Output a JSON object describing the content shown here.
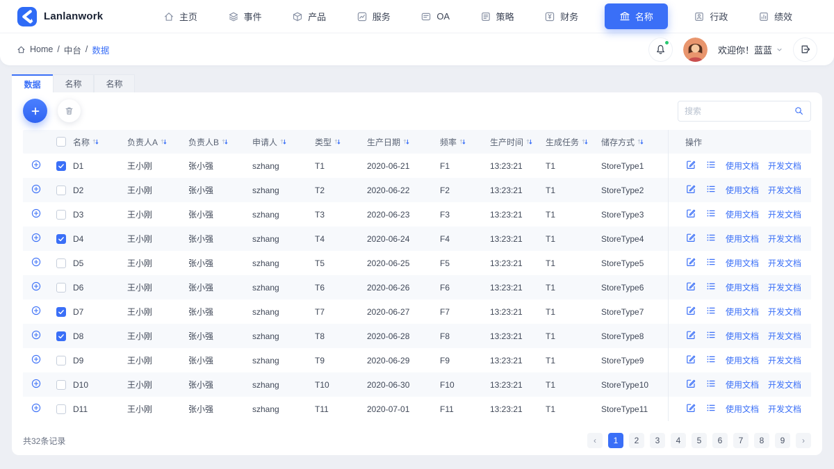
{
  "brand": {
    "name": "Lanlanwork"
  },
  "nav": {
    "items": [
      {
        "label": "主页",
        "icon": "home",
        "active": false
      },
      {
        "label": "事件",
        "icon": "layers",
        "active": false
      },
      {
        "label": "产品",
        "icon": "box",
        "active": false
      },
      {
        "label": "服务",
        "icon": "chart",
        "active": false
      },
      {
        "label": "OA",
        "icon": "oa",
        "active": false
      },
      {
        "label": "策略",
        "icon": "strategy",
        "active": false
      },
      {
        "label": "财务",
        "icon": "finance",
        "active": false
      },
      {
        "label": "名称",
        "icon": "bank",
        "active": true
      },
      {
        "label": "行政",
        "icon": "admin",
        "active": false
      },
      {
        "label": "绩效",
        "icon": "performance",
        "active": false
      }
    ]
  },
  "header": {
    "breadcrumb": {
      "root": "Home",
      "separator1": "/",
      "section": "中台",
      "separator2": "/",
      "current": "数据"
    },
    "greeting": "欢迎你！蓝蓝"
  },
  "tabs": [
    {
      "label": "数据",
      "active": true
    },
    {
      "label": "名称",
      "active": false
    },
    {
      "label": "名称",
      "active": false
    }
  ],
  "toolbar": {
    "search_placeholder": "搜索"
  },
  "table": {
    "columns": [
      "名称",
      "负责人A",
      "负责人B",
      "申请人",
      "类型",
      "生产日期",
      "频率",
      "生产时间",
      "生成任务",
      "储存方式"
    ],
    "ops_header": "操作",
    "ops_links": [
      "使用文档",
      "开发文档"
    ],
    "rows": [
      {
        "name": "D1",
        "ownerA": "王小刚",
        "ownerB": "张小强",
        "applicant": "szhang",
        "type": "T1",
        "date": "2020-06-21",
        "freq": "F1",
        "time": "13:23:21",
        "task": "T1",
        "store": "StoreType1",
        "checked": true
      },
      {
        "name": "D2",
        "ownerA": "王小刚",
        "ownerB": "张小强",
        "applicant": "szhang",
        "type": "T2",
        "date": "2020-06-22",
        "freq": "F2",
        "time": "13:23:21",
        "task": "T1",
        "store": "StoreType2",
        "checked": false
      },
      {
        "name": "D3",
        "ownerA": "王小刚",
        "ownerB": "张小强",
        "applicant": "szhang",
        "type": "T3",
        "date": "2020-06-23",
        "freq": "F3",
        "time": "13:23:21",
        "task": "T1",
        "store": "StoreType3",
        "checked": false
      },
      {
        "name": "D4",
        "ownerA": "王小刚",
        "ownerB": "张小强",
        "applicant": "szhang",
        "type": "T4",
        "date": "2020-06-24",
        "freq": "F4",
        "time": "13:23:21",
        "task": "T1",
        "store": "StoreType4",
        "checked": true
      },
      {
        "name": "D5",
        "ownerA": "王小刚",
        "ownerB": "张小强",
        "applicant": "szhang",
        "type": "T5",
        "date": "2020-06-25",
        "freq": "F5",
        "time": "13:23:21",
        "task": "T1",
        "store": "StoreType5",
        "checked": false
      },
      {
        "name": "D6",
        "ownerA": "王小刚",
        "ownerB": "张小强",
        "applicant": "szhang",
        "type": "T6",
        "date": "2020-06-26",
        "freq": "F6",
        "time": "13:23:21",
        "task": "T1",
        "store": "StoreType6",
        "checked": false
      },
      {
        "name": "D7",
        "ownerA": "王小刚",
        "ownerB": "张小强",
        "applicant": "szhang",
        "type": "T7",
        "date": "2020-06-27",
        "freq": "F7",
        "time": "13:23:21",
        "task": "T1",
        "store": "StoreType7",
        "checked": true
      },
      {
        "name": "D8",
        "ownerA": "王小刚",
        "ownerB": "张小强",
        "applicant": "szhang",
        "type": "T8",
        "date": "2020-06-28",
        "freq": "F8",
        "time": "13:23:21",
        "task": "T1",
        "store": "StoreType8",
        "checked": true
      },
      {
        "name": "D9",
        "ownerA": "王小刚",
        "ownerB": "张小强",
        "applicant": "szhang",
        "type": "T9",
        "date": "2020-06-29",
        "freq": "F9",
        "time": "13:23:21",
        "task": "T1",
        "store": "StoreType9",
        "checked": false
      },
      {
        "name": "D10",
        "ownerA": "王小刚",
        "ownerB": "张小强",
        "applicant": "szhang",
        "type": "T10",
        "date": "2020-06-30",
        "freq": "F10",
        "time": "13:23:21",
        "task": "T1",
        "store": "StoreType10",
        "checked": false
      },
      {
        "name": "D11",
        "ownerA": "王小刚",
        "ownerB": "张小强",
        "applicant": "szhang",
        "type": "T11",
        "date": "2020-07-01",
        "freq": "F11",
        "time": "13:23:21",
        "task": "T1",
        "store": "StoreType11",
        "checked": false
      }
    ]
  },
  "footer": {
    "total_label": "共32条记录",
    "pages": [
      "1",
      "2",
      "3",
      "4",
      "5",
      "6",
      "7",
      "8",
      "9"
    ],
    "active_page": "1",
    "prev": "‹",
    "next": "›"
  },
  "colors": {
    "primary": "#3A6FF7",
    "online_dot": "#28C76F"
  }
}
